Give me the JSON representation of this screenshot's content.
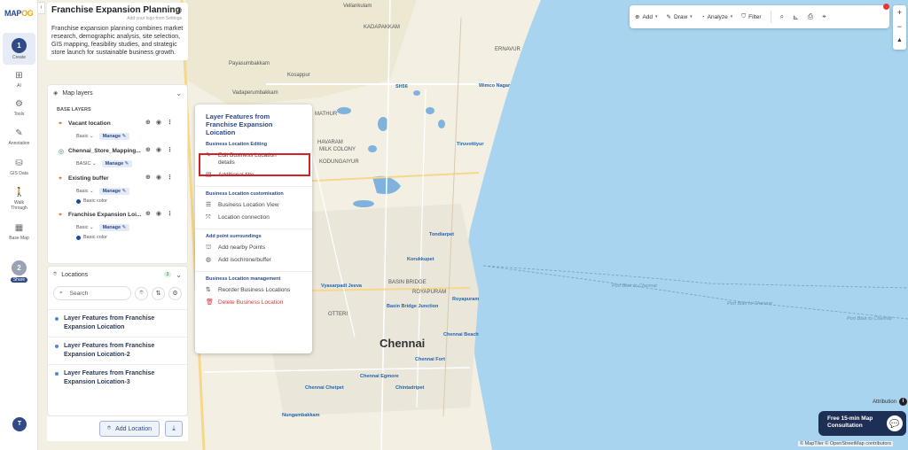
{
  "app": {
    "logo_prefix": "MAP",
    "logo_suffix": "OG",
    "user_initial": "T"
  },
  "rail": {
    "step1_number": "1",
    "step1_label": "Create",
    "items": [
      {
        "label": "AI",
        "icon": "ai-icon"
      },
      {
        "label": "Tools",
        "icon": "tools-icon"
      },
      {
        "label": "Annotation",
        "icon": "annotation-icon"
      },
      {
        "label": "GIS Data",
        "icon": "gis-data-icon"
      },
      {
        "label": "Walk Through",
        "icon": "walk-icon"
      },
      {
        "label": "Base Map",
        "icon": "base-map-icon"
      }
    ],
    "step2_number": "2",
    "step2_label": "Share"
  },
  "project": {
    "title": "Franchise Expansion Planning",
    "logo_hint": "Add your logo from Settings",
    "description": "Franchise expansion planning combines market research, demographic analysis, site selection, GIS mapping, feasibility studies, and strategic store launch for sustainable business growth."
  },
  "map_layers": {
    "header": "Map layers",
    "section_title": "BASE LAYERS",
    "manage_label": "Manage",
    "layers": [
      {
        "name": "Vacant location",
        "style": "Basic",
        "has_color": false
      },
      {
        "name": "Chennai_Store_Mapping...",
        "style": "BASIC",
        "has_color": false
      },
      {
        "name": "Existing buffer",
        "style": "Basic",
        "has_color": true,
        "color_label": "Basic color"
      },
      {
        "name": "Franchise Expansion Loi...",
        "style": "Basic",
        "has_color": true,
        "color_label": "Basic color"
      }
    ]
  },
  "locations": {
    "header": "Locations",
    "count": "3",
    "search_placeholder": "Search",
    "items": [
      "Layer Features from Franchise Expansion Loication",
      "Layer Features from Franchise Expansion Loication-2",
      "Layer Features from Franchise Expansion Loication-3"
    ],
    "add_button": "Add Location"
  },
  "menu": {
    "title": "Layer Features from Franchise Expansion Loication",
    "sections": [
      {
        "title": "Business Location Editing",
        "items": [
          {
            "label": "Edit Business Location details",
            "icon": "edit-icon",
            "danger": false
          },
          {
            "label": "Additional title",
            "icon": "title-icon",
            "danger": false
          }
        ]
      },
      {
        "title": "Business Location customisation",
        "items": [
          {
            "label": "Business Location View",
            "icon": "list-icon",
            "danger": false
          },
          {
            "label": "Location connection",
            "icon": "connection-icon",
            "danger": false
          }
        ]
      },
      {
        "title": "Add point surroundings",
        "items": [
          {
            "label": "Add nearby Points",
            "icon": "nearby-icon",
            "danger": false
          },
          {
            "label": "Add isochrone/buffer",
            "icon": "isochrone-icon",
            "danger": false
          }
        ]
      },
      {
        "title": "Business Location management",
        "items": [
          {
            "label": "Reorder Business Locations",
            "icon": "reorder-icon",
            "danger": true
          },
          {
            "label": "Delete Business Location",
            "icon": "delete-icon",
            "danger": true
          }
        ]
      }
    ]
  },
  "toolbar": {
    "add": "Add",
    "draw": "Draw",
    "analyze": "Analyze",
    "filter": "Filter"
  },
  "zoom": {
    "in": "+",
    "out": "−"
  },
  "attribution": "Attribution",
  "consult": {
    "line1": "Free 15-min Map",
    "line2": "Consultation"
  },
  "credits": "© MapTiler © OpenStreetMap contributors",
  "map_labels": [
    {
      "text": "Vellankulam"
    },
    {
      "text": "KADAPAKKAM"
    },
    {
      "text": "ERNAVUR"
    },
    {
      "text": "Payasumbakkam"
    },
    {
      "text": "Kosappur"
    },
    {
      "text": "Vadaperumbakkam"
    },
    {
      "text": "Wimco Nagar"
    },
    {
      "text": "MATHUR"
    },
    {
      "text": "HAVARAM"
    },
    {
      "text": "MILK COLONY"
    },
    {
      "text": "KODUNGAIYUR"
    },
    {
      "text": "Tiruvottiyur"
    },
    {
      "text": "Tondiarpet"
    },
    {
      "text": "Korukkupet"
    },
    {
      "text": "Vyasarpadi Jeeva"
    },
    {
      "text": "BASIN BRIDGE"
    },
    {
      "text": "Basin Bridge Junction"
    },
    {
      "text": "Royapuram"
    },
    {
      "text": "Chennai Beach"
    },
    {
      "text": "Chennai Fort"
    },
    {
      "text": "Chennai Egmore"
    },
    {
      "text": "Chennai Chetpet"
    },
    {
      "text": "Chintadripet"
    },
    {
      "text": "Nungambakkam"
    },
    {
      "text": "Chennai"
    },
    {
      "text": "Port Blair to Chennai"
    },
    {
      "text": "SH56"
    },
    {
      "text": "OTTERI"
    },
    {
      "text": "ROYAPURAM"
    }
  ]
}
